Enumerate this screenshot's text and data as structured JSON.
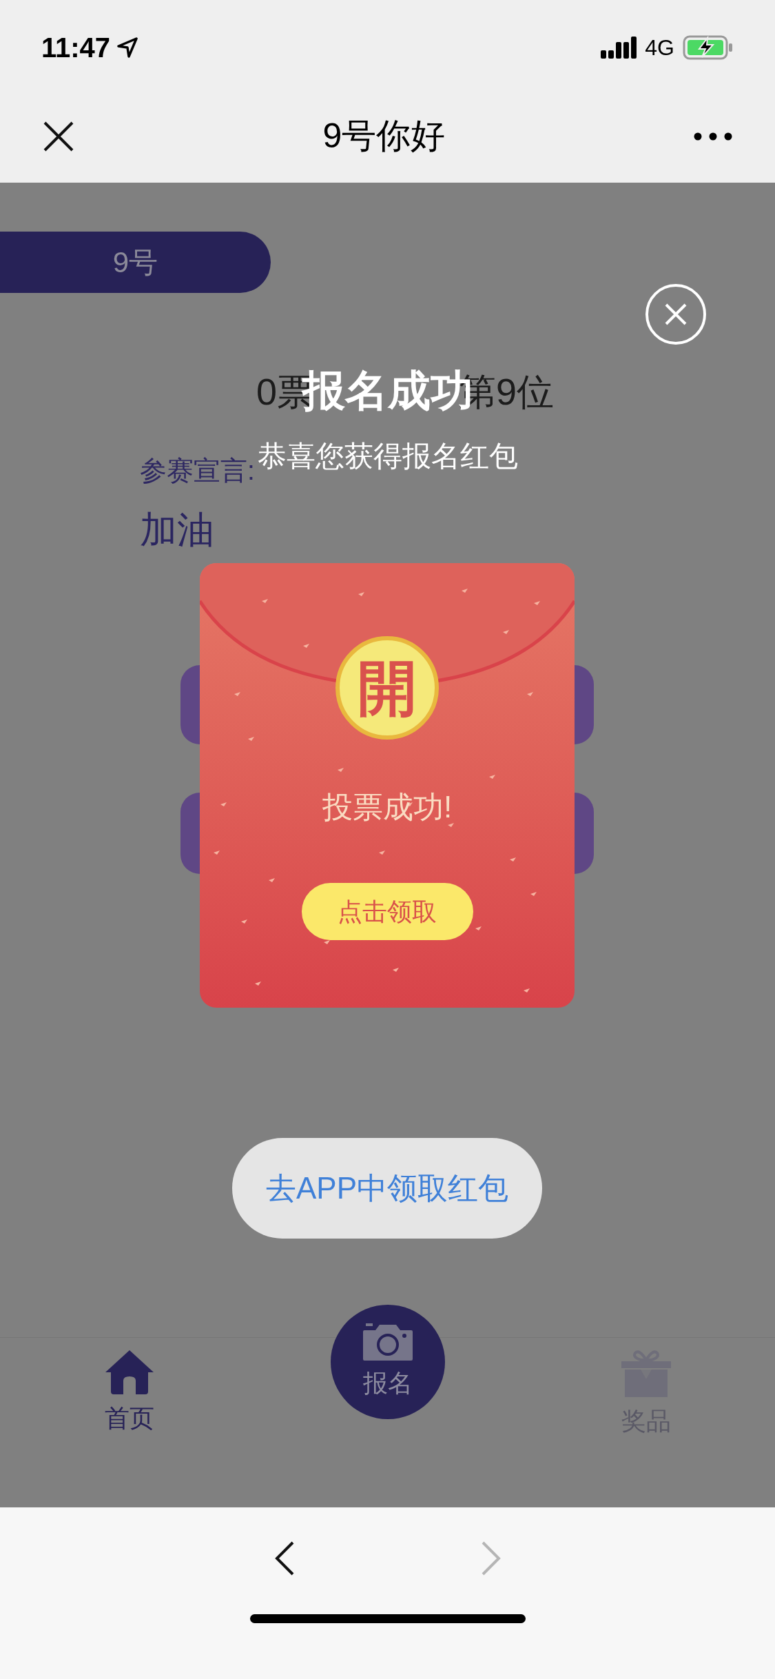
{
  "status_bar": {
    "time": "11:47",
    "network": "4G"
  },
  "nav_bar": {
    "title": "9号你好"
  },
  "contestant": {
    "number_tag": "9号",
    "votes": "0票",
    "rank": "第9位",
    "declaration_label": "参赛宣言:",
    "declaration": "加油"
  },
  "modal": {
    "title": "报名成功",
    "subtitle": "恭喜您获得报名红包",
    "envelope": {
      "seal": "開",
      "message": "投票成功!",
      "button": "点击领取"
    }
  },
  "toast": "去APP中领取红包",
  "tab_bar": [
    {
      "label": "首页",
      "kind": "home",
      "selected": true
    },
    {
      "label": "报名",
      "kind": "camera",
      "selected": false
    },
    {
      "label": "奖品",
      "kind": "gift",
      "selected": false
    }
  ],
  "browser_bar": {
    "back_enabled": true,
    "forward_enabled": false
  }
}
